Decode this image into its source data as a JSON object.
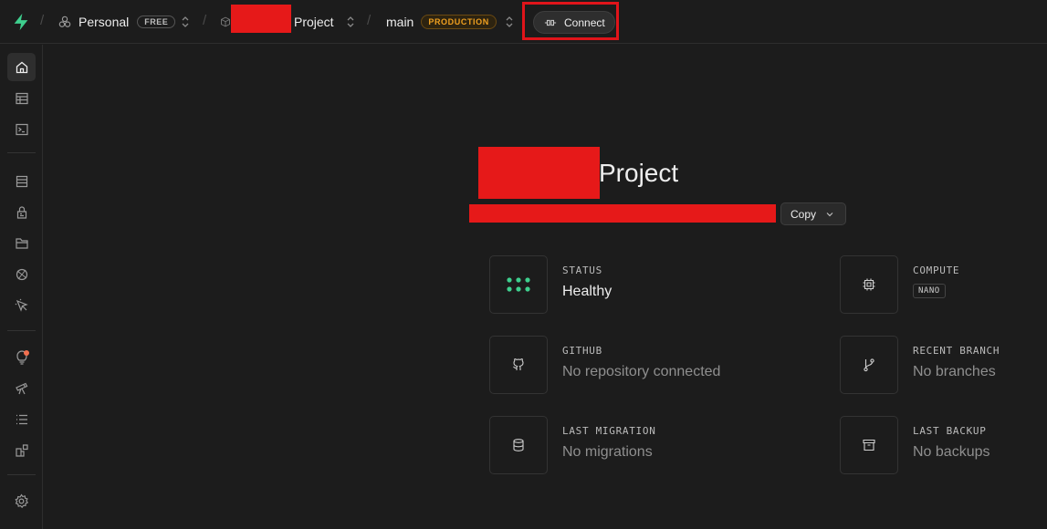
{
  "header": {
    "org_name": "Personal",
    "org_plan_badge": "FREE",
    "project_name_suffix": "Project",
    "branch_name": "main",
    "branch_badge": "PRODUCTION",
    "connect_label": "Connect"
  },
  "sidebar": {
    "items": [
      {
        "name": "home",
        "icon": "home-icon",
        "active": true
      },
      {
        "name": "table-editor",
        "icon": "table-icon"
      },
      {
        "name": "sql-editor",
        "icon": "terminal-icon"
      },
      {
        "name": "database",
        "icon": "database-icon"
      },
      {
        "name": "authentication",
        "icon": "lock-icon"
      },
      {
        "name": "storage",
        "icon": "folder-icon"
      },
      {
        "name": "realtime",
        "icon": "realtime-icon"
      },
      {
        "name": "edge-functions",
        "icon": "pointer-icon"
      },
      {
        "name": "advisors",
        "icon": "lightbulb-icon"
      },
      {
        "name": "observability",
        "icon": "telescope-icon"
      },
      {
        "name": "logs",
        "icon": "list-icon"
      },
      {
        "name": "integrations",
        "icon": "integrations-icon"
      },
      {
        "name": "settings",
        "icon": "gear-icon"
      }
    ]
  },
  "main": {
    "title_suffix": "Project",
    "copy_label": "Copy",
    "cards": {
      "status": {
        "label": "STATUS",
        "value": "Healthy",
        "icon": "status-dots-icon",
        "accent": "#3ecf8e"
      },
      "compute": {
        "label": "COMPUTE",
        "value": "NANO",
        "icon": "chip-icon"
      },
      "github": {
        "label": "GITHUB",
        "value": "No repository connected",
        "icon": "github-icon"
      },
      "recent_branch": {
        "label": "RECENT BRANCH",
        "value": "No branches",
        "icon": "git-branch-icon"
      },
      "last_migration": {
        "label": "LAST MIGRATION",
        "value": "No migrations",
        "icon": "database-icon"
      },
      "last_backup": {
        "label": "LAST BACKUP",
        "value": "No backups",
        "icon": "archive-icon"
      }
    }
  },
  "colors": {
    "brand": "#3ecf8e",
    "background": "#1c1c1c",
    "production_accent": "#f0a020",
    "redaction": "#e61919",
    "highlight_box": "#e0141a"
  }
}
